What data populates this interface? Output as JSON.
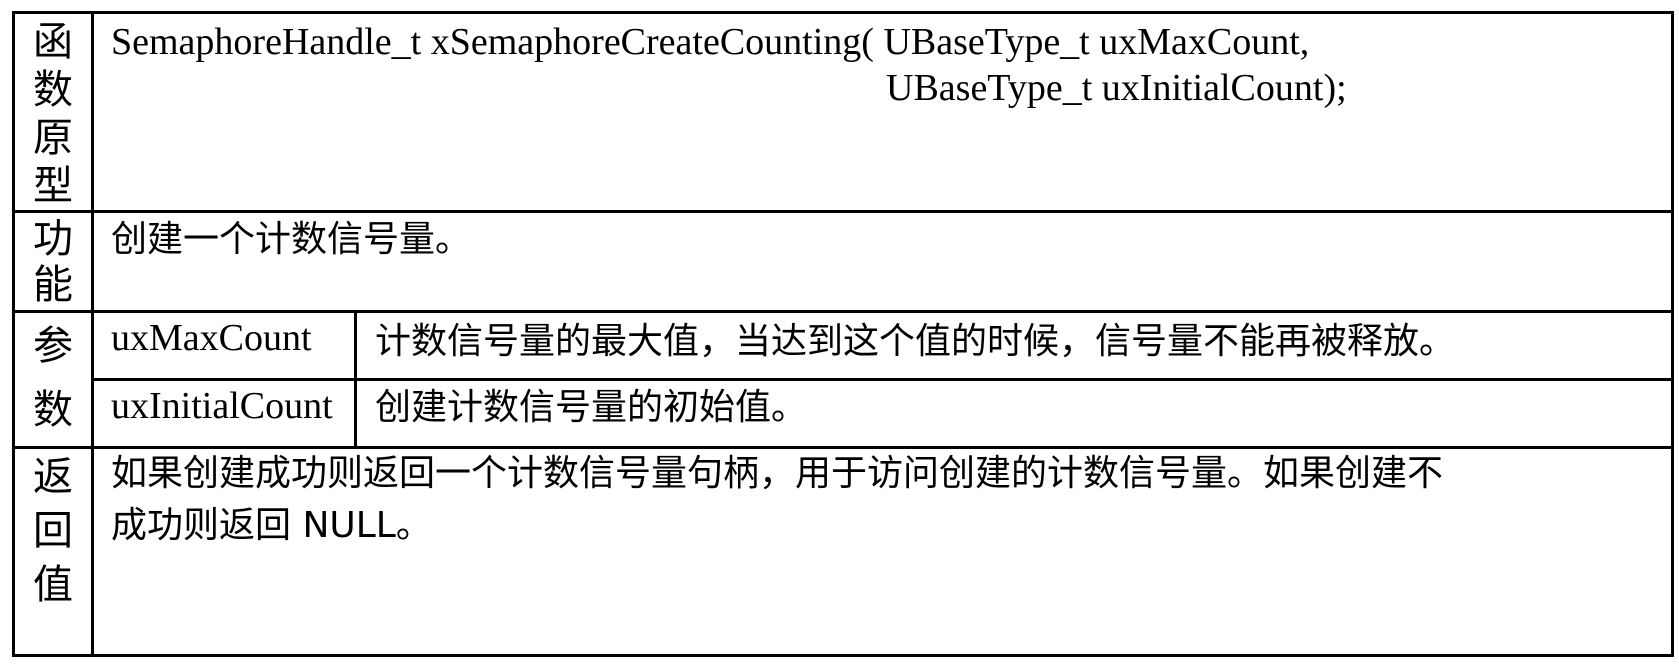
{
  "rows": {
    "prototype": {
      "label": "函数原型",
      "line1": "SemaphoreHandle_t xSemaphoreCreateCounting( UBaseType_t uxMaxCount,",
      "line2": "UBaseType_t uxInitialCount);"
    },
    "function": {
      "label": "功能",
      "text": "创建一个计数信号量。"
    },
    "params": {
      "label": "参数",
      "items": [
        {
          "name": "uxMaxCount",
          "desc": "计数信号量的最大值，当达到这个值的时候，信号量不能再被释放。"
        },
        {
          "name": "uxInitialCount",
          "desc": "创建计数信号量的初始值。"
        }
      ]
    },
    "return": {
      "label": "返回值",
      "line1": "如果创建成功则返回一个计数信号量句柄，用于访问创建的计数信号量。如果创建不",
      "line2": "成功则返回 NULL。"
    }
  }
}
